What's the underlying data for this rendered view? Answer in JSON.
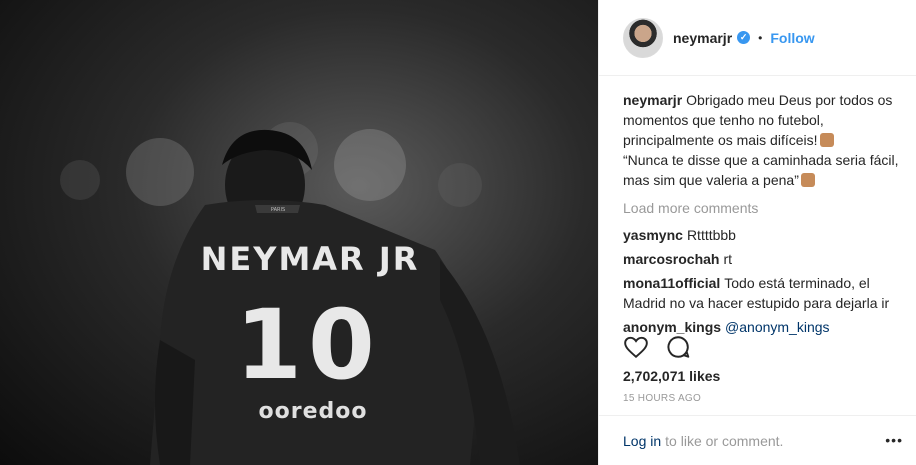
{
  "post": {
    "image_alt": "Black and white photo of player wearing NEYMAR JR 10 shirt",
    "shirt": {
      "name": "NEYMAR JR",
      "number": "10",
      "sponsor": "ooredoo",
      "collar": "PARIS"
    }
  },
  "header": {
    "username": "neymarjr",
    "verified_mark": "✓",
    "separator": "•",
    "follow_label": "Follow"
  },
  "caption": {
    "username": "neymarjr",
    "text_1": "Obrigado meu Deus por todos os momentos que tenho no futebol, principalmente os mais difíceis!",
    "text_2": "“Nunca te disse que a caminhada seria fácil, mas sim que valeria a pena”"
  },
  "load_more_label": "Load more comments",
  "comments": [
    {
      "username": "yasmync",
      "text": "Rttttbbb"
    },
    {
      "username": "marcosrochah",
      "text": "rt"
    },
    {
      "username": "mona11official",
      "text": "Todo está terminado, el Madrid no va hacer estupido para dejarla ir"
    },
    {
      "username": "anonym_kings",
      "mention": "@anonym_kings"
    }
  ],
  "likes": "2,702,071 likes",
  "timestamp": "15 HOURS AGO",
  "footer": {
    "login_label": "Log in",
    "rest": "to like or comment.",
    "more_label": "•••"
  },
  "icons": {
    "like": "heart-icon",
    "comment": "comment-bubble-icon",
    "more": "more-options-icon"
  },
  "colors": {
    "link": "#3897f0",
    "dark_link": "#003569",
    "muted": "#999999"
  }
}
